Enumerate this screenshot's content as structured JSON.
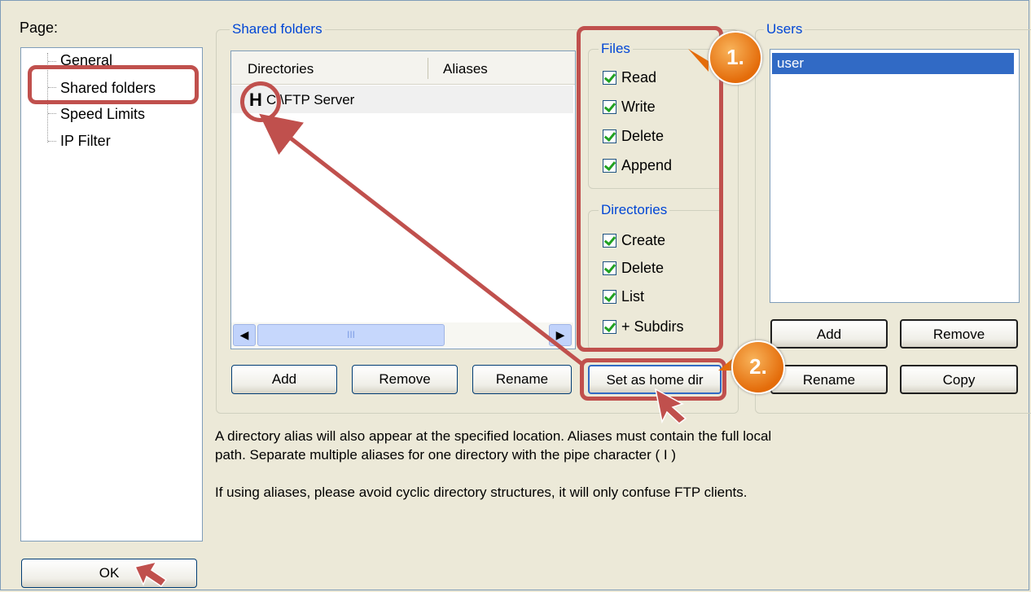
{
  "page_label": "Page:",
  "tree": {
    "items": [
      "General",
      "Shared folders",
      "Speed Limits",
      "IP Filter"
    ]
  },
  "shared": {
    "group_title": "Shared folders",
    "columns": [
      "Directories",
      "Aliases"
    ],
    "rows": [
      {
        "home_marker": "H",
        "path": "C:\\FTP Server"
      }
    ],
    "scroll_thumb_glyph": "III",
    "buttons": {
      "add": "Add",
      "remove": "Remove",
      "rename": "Rename",
      "set_home": "Set as home dir"
    }
  },
  "files": {
    "title": "Files",
    "options": [
      {
        "label": "Read",
        "checked": true
      },
      {
        "label": "Write",
        "checked": true
      },
      {
        "label": "Delete",
        "checked": true
      },
      {
        "label": "Append",
        "checked": true
      }
    ]
  },
  "directories": {
    "title": "Directories",
    "options": [
      {
        "label": "Create",
        "checked": true
      },
      {
        "label": "Delete",
        "checked": true
      },
      {
        "label": "List",
        "checked": true
      },
      {
        "label": "+ Subdirs",
        "checked": true
      }
    ]
  },
  "users": {
    "title": "Users",
    "list": [
      "user"
    ],
    "buttons": {
      "add": "Add",
      "remove": "Remove",
      "rename": "Rename",
      "copy": "Copy"
    }
  },
  "description": {
    "line1": "A directory alias will also appear at the specified location. Aliases must contain the full local",
    "line2": "path. Separate multiple aliases for one directory with the pipe character ( I )",
    "line3": "If using aliases, please avoid cyclic directory structures, it will only confuse FTP clients."
  },
  "ok_button": "OK",
  "annotations": {
    "badge1": "1.",
    "badge2": "2."
  },
  "colors": {
    "highlight": "#c0504d",
    "badge": "#e46c0a",
    "selection": "#316ac5",
    "group_title": "#0046d5"
  }
}
